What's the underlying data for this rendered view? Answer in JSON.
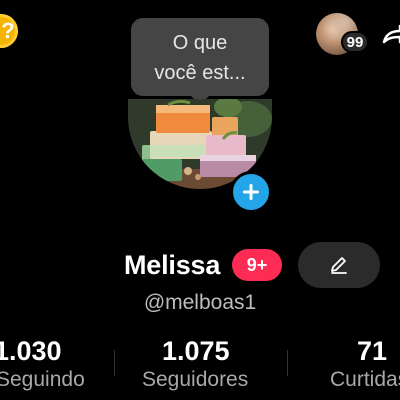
{
  "status": {
    "line1": "O que",
    "line2": "você est..."
  },
  "notifications": {
    "count": "99"
  },
  "profile": {
    "name": "Melissa",
    "name_badge": "9+",
    "username": "@melboas1"
  },
  "stats": {
    "following": {
      "value": "1.030",
      "label": "Seguindo"
    },
    "followers": {
      "value": "1.075",
      "label": "Seguidores"
    },
    "likes": {
      "value": "71",
      "label": "Curtidas"
    }
  },
  "icons": {
    "coin": "question-coin-icon",
    "share": "share-arrow-icon",
    "add": "plus-icon",
    "edit": "pencil-icon"
  },
  "colors": {
    "background": "#000000",
    "accent_blue": "#23a5e8",
    "badge_red": "#fe2c55",
    "coin_gold": "#f5b400",
    "button_dark": "#2b2b2b"
  }
}
